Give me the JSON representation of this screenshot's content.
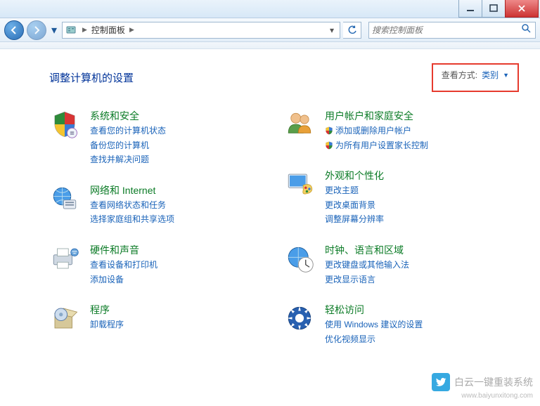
{
  "window": {
    "breadcrumb_root": "控制面板",
    "search_placeholder": "搜索控制面板"
  },
  "header": {
    "title": "调整计算机的设置",
    "view_label": "查看方式:",
    "view_value": "类别"
  },
  "categories": {
    "left": [
      {
        "title": "系统和安全",
        "subs": [
          "查看您的计算机状态",
          "备份您的计算机",
          "查找并解决问题"
        ],
        "icon": "shield"
      },
      {
        "title": "网络和 Internet",
        "subs": [
          "查看网络状态和任务",
          "选择家庭组和共享选项"
        ],
        "icon": "globe"
      },
      {
        "title": "硬件和声音",
        "subs": [
          "查看设备和打印机",
          "添加设备"
        ],
        "icon": "printer"
      },
      {
        "title": "程序",
        "subs": [
          "卸载程序"
        ],
        "icon": "box"
      }
    ],
    "right": [
      {
        "title": "用户帐户和家庭安全",
        "subs_shield": [
          "添加或删除用户帐户",
          "为所有用户设置家长控制"
        ],
        "icon": "users"
      },
      {
        "title": "外观和个性化",
        "subs": [
          "更改主题",
          "更改桌面背景",
          "调整屏幕分辨率"
        ],
        "icon": "palette"
      },
      {
        "title": "时钟、语言和区域",
        "subs": [
          "更改键盘或其他输入法",
          "更改显示语言"
        ],
        "icon": "clock"
      },
      {
        "title": "轻松访问",
        "subs": [
          "使用 Windows 建议的设置",
          "优化视频显示"
        ],
        "icon": "ease"
      }
    ]
  },
  "watermark": {
    "brand": "白云一键重装系统",
    "url": "www.baiyunxitong.com"
  }
}
